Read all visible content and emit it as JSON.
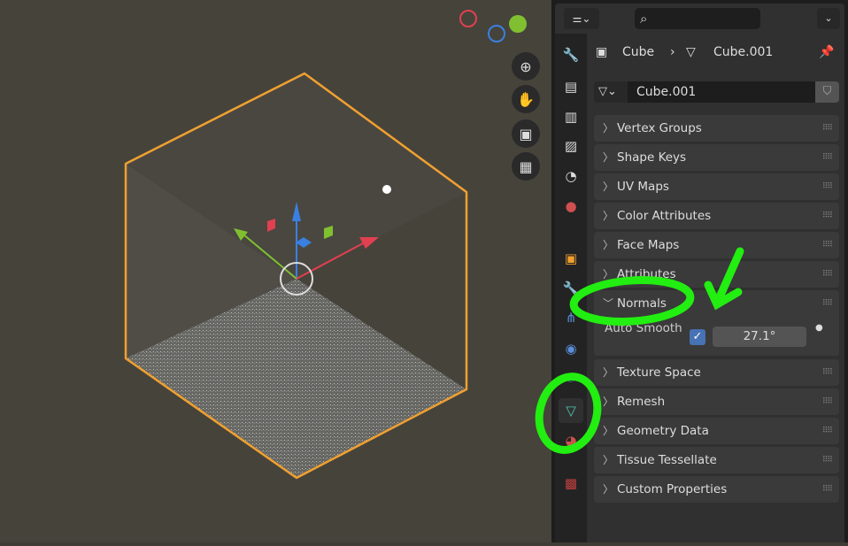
{
  "viewport": {
    "nav_buttons": [
      "zoom-icon",
      "hand-pan-icon",
      "camera-icon",
      "grid-icon"
    ]
  },
  "properties": {
    "breadcrumb": {
      "object": "Cube",
      "mesh": "Cube.001"
    },
    "mesh_name": "Cube.001",
    "panels": [
      {
        "label": "Vertex Groups",
        "expanded": false
      },
      {
        "label": "Shape Keys",
        "expanded": false
      },
      {
        "label": "UV Maps",
        "expanded": false
      },
      {
        "label": "Color Attributes",
        "expanded": false
      },
      {
        "label": "Face Maps",
        "expanded": false
      },
      {
        "label": "Attributes",
        "expanded": false
      },
      {
        "label": "Normals",
        "expanded": true
      },
      {
        "label": "Texture Space",
        "expanded": false
      },
      {
        "label": "Remesh",
        "expanded": false
      },
      {
        "label": "Geometry Data",
        "expanded": false
      },
      {
        "label": "Tissue Tessellate",
        "expanded": false
      },
      {
        "label": "Custom Properties",
        "expanded": false
      }
    ],
    "normals": {
      "auto_smooth_label": "Auto Smooth",
      "auto_smooth": true,
      "angle": "27.1°"
    }
  },
  "colors": {
    "selection": "#f0a030",
    "annotation": "#22ee11",
    "accent": "#4772b3"
  }
}
